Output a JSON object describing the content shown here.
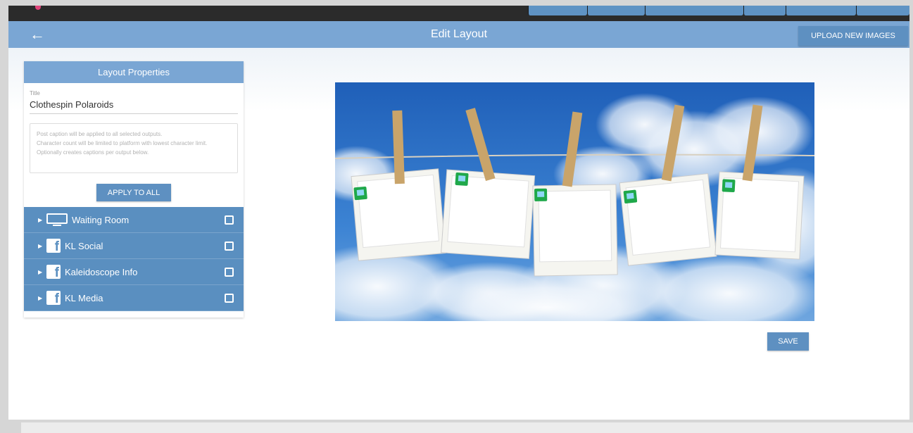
{
  "header": {
    "title": "Edit Layout",
    "back_icon": "arrow-left-icon",
    "upload_label": "UPLOAD NEW IMAGES"
  },
  "panel": {
    "heading": "Layout Properties",
    "title_label": "Title",
    "title_value": "Clothespin Polaroids",
    "caption_placeholder": [
      "Post caption will be applied to all selected outputs.",
      "Character count will be limited to platform with lowest character limit.",
      "Optionally creates captions per output below."
    ],
    "apply_label": "APPLY TO ALL",
    "outputs": [
      {
        "label": "Waiting Room",
        "icon": "tv-icon",
        "checked": false
      },
      {
        "label": "KL Social",
        "icon": "facebook-icon",
        "checked": false
      },
      {
        "label": "Kaleidoscope Info",
        "icon": "facebook-icon",
        "checked": false
      },
      {
        "label": "KL Media",
        "icon": "facebook-icon",
        "checked": false
      }
    ]
  },
  "preview": {
    "frame_count": 5,
    "badge_icon": "image-placeholder-icon"
  },
  "actions": {
    "save_label": "SAVE"
  },
  "colors": {
    "header": "#7aa6d4",
    "button": "#5e90c1",
    "output_row": "#5a8fc0",
    "sky": "#2e6ec2"
  }
}
